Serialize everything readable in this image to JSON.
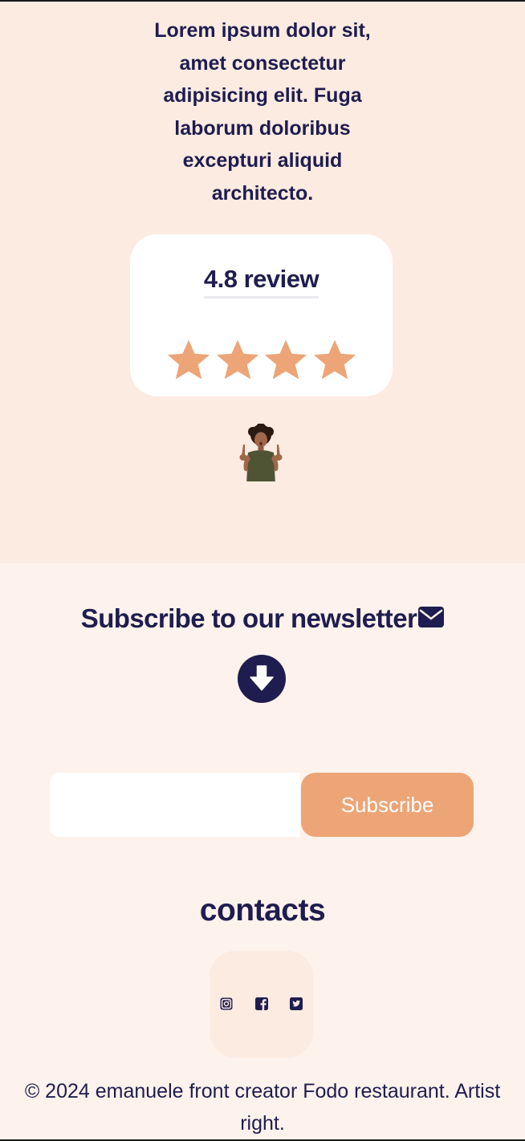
{
  "intro": {
    "text": "Lorem ipsum dolor sit, amet consectetur adipisicing elit. Fuga laborum doloribus excepturi aliquid architecto."
  },
  "review": {
    "title": "4.8 review",
    "stars_shown": 4,
    "star_color": "#eda577"
  },
  "avatar": {
    "icon": "person-pointing-up-avatar"
  },
  "newsletter": {
    "title": "Subscribe to our newsletter",
    "title_icon": "envelope-icon",
    "arrow_icon": "arrow-down-circle-icon",
    "email_placeholder": "",
    "email_value": "",
    "subscribe_label": "Subscribe"
  },
  "contacts": {
    "title": "contacts",
    "socials": [
      {
        "name": "instagram",
        "icon": "instagram-icon"
      },
      {
        "name": "facebook",
        "icon": "facebook-icon"
      },
      {
        "name": "twitter",
        "icon": "twitter-icon"
      }
    ]
  },
  "footer": {
    "copyright": "© 2024 emanuele front creator Fodo restaurant. Artist right."
  },
  "colors": {
    "text": "#1f1d4f",
    "hero_background": "#fcebe1",
    "page_background": "#fdf2ec",
    "accent": "#eda577",
    "card_background": "#ffffff"
  }
}
